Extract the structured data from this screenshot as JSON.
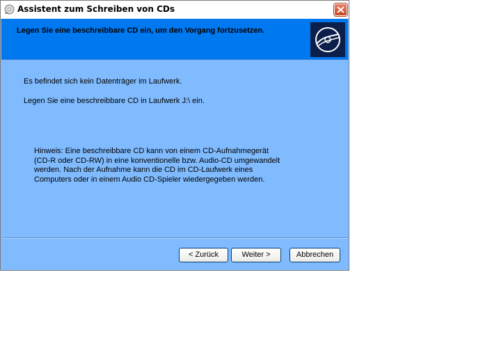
{
  "window": {
    "title": "Assistent zum Schreiben von CDs"
  },
  "header": {
    "heading": "Legen Sie eine beschreibbare CD ein, um den Vorgang fortzusetzen.",
    "icon": "cd-disc-icon"
  },
  "body": {
    "line1": "Es befindet sich kein Datenträger im Laufwerk.",
    "line2": "Legen Sie eine beschreibbare CD in Laufwerk J:\\ ein.",
    "hint": "Hinweis: Eine beschreibbare CD kann von einem CD-Aufnahmegerät (CD-R oder CD-RW) in eine konventionelle bzw. Audio-CD umgewandelt werden. Nach der Aufnahme kann die CD im CD-Laufwerk eines Computers oder in einem Audio CD-Spieler wiedergegeben werden."
  },
  "buttons": {
    "back": "< Zurück",
    "next": "Weiter >",
    "cancel": "Abbrechen"
  },
  "colors": {
    "header_bg": "#0078f0",
    "body_bg": "#80bbff",
    "close_button": "#c74424"
  }
}
